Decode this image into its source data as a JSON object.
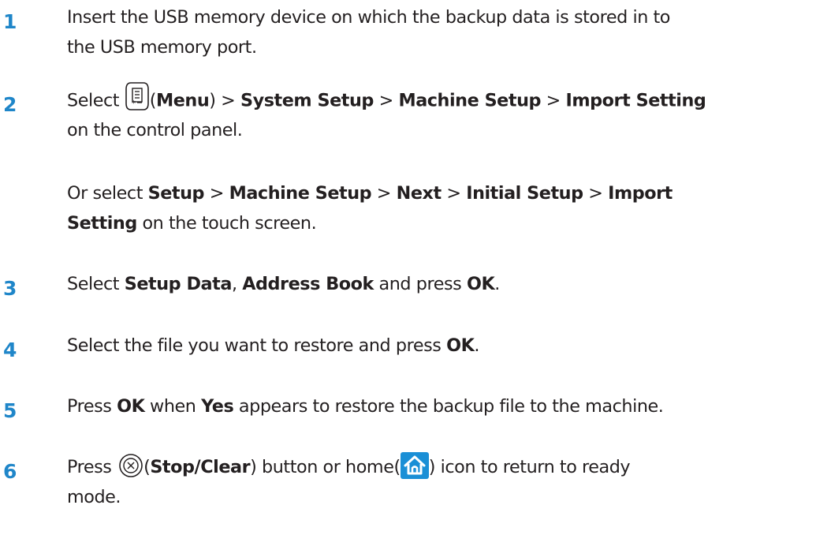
{
  "steps": [
    {
      "number": "1",
      "lines": [
        [
          "Insert the USB memory device on which the backup data is stored in to"
        ],
        [
          "the USB memory port."
        ]
      ]
    },
    {
      "number": "2",
      "parts": {
        "select": "Select ",
        "open_paren": "(",
        "menu": "Menu",
        "close_paren": ") > ",
        "system_setup": "System Setup",
        "sep1": " > ",
        "machine_setup": "Machine Setup",
        "sep2": " > ",
        "import_setting": "Import Setting",
        "line2": "on the control panel."
      },
      "alt": {
        "or_select": "Or select ",
        "setup": "Setup",
        "sep1": " > ",
        "machine_setup": "Machine Setup",
        "sep2": " > ",
        "next": "Next",
        "sep3": " > ",
        "initial_setup": "Initial Setup",
        "sep4": " > ",
        "import": "Import",
        "setting": "Setting",
        "tail": " on the touch screen."
      },
      "icon": "menu-icon"
    },
    {
      "number": "3",
      "parts": {
        "select": "Select ",
        "setup_data": "Setup Data",
        "comma": ", ",
        "address_book": "Address Book",
        "and_press": " and press ",
        "ok": "OK",
        "period": "."
      }
    },
    {
      "number": "4",
      "parts": {
        "text": "Select the file you want to restore and press ",
        "ok": "OK",
        "period": "."
      }
    },
    {
      "number": "5",
      "parts": {
        "press": "Press ",
        "ok": "OK",
        "when": " when ",
        "yes": "Yes",
        "rest": " appears to restore the backup file to the machine."
      }
    },
    {
      "number": "6",
      "parts": {
        "press": "Press ",
        "open_paren": "(",
        "stop_clear": "Stop/Clear",
        "mid": ") button or home(",
        "rest": ") icon to return to ready",
        "line2": "mode."
      },
      "icons": [
        "stop-clear-icon",
        "home-icon"
      ]
    }
  ],
  "colors": {
    "step_number": "#1f86c9",
    "text": "#231f20",
    "home_icon_bg": "#1a8fd6"
  }
}
